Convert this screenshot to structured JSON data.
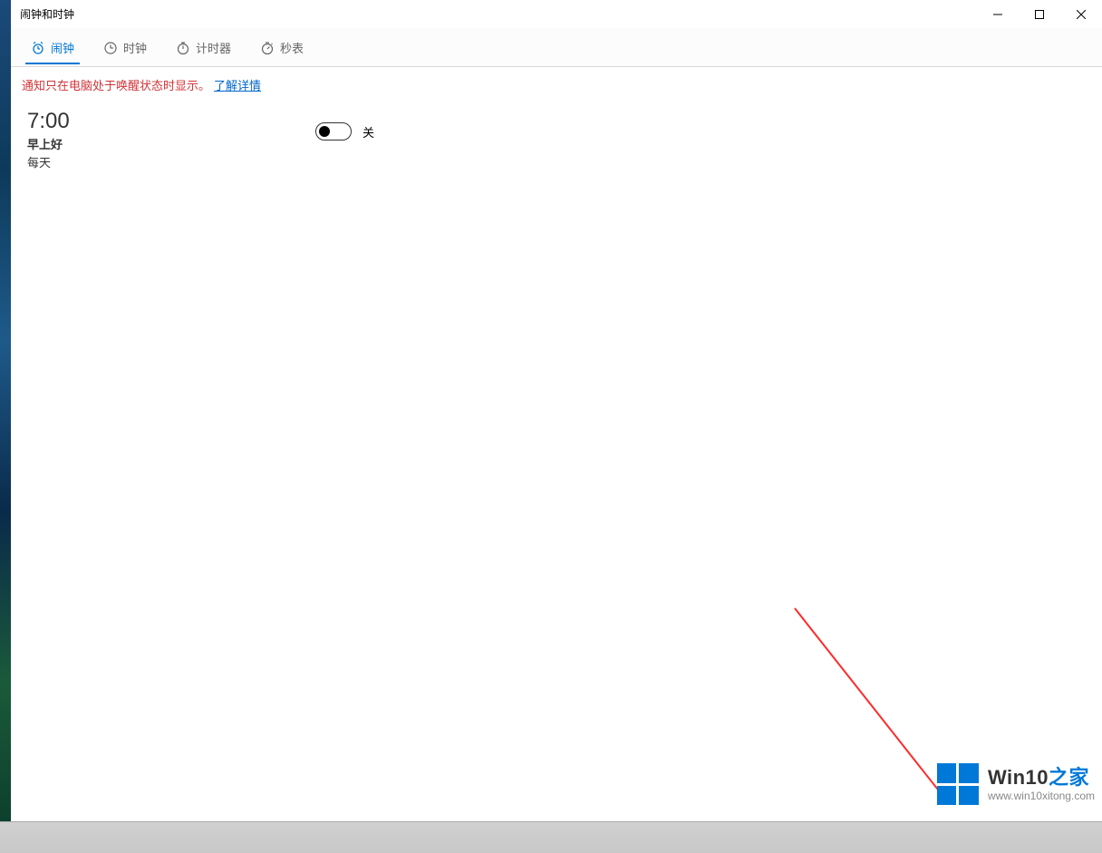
{
  "window": {
    "title": "闹钟和时钟"
  },
  "tabs": [
    {
      "label": "闹钟",
      "active": true
    },
    {
      "label": "时钟",
      "active": false
    },
    {
      "label": "计时器",
      "active": false
    },
    {
      "label": "秒表",
      "active": false
    }
  ],
  "notice": {
    "text": "通知只在电脑处于唤醒状态时显示。",
    "link": "了解详情"
  },
  "alarms": [
    {
      "time": "7:00",
      "name": "早上好",
      "repeat": "每天",
      "toggle_state": "关"
    }
  ],
  "watermark": {
    "title_prefix": "Win10",
    "title_suffix": "之家",
    "url": "www.win10xitong.com"
  }
}
